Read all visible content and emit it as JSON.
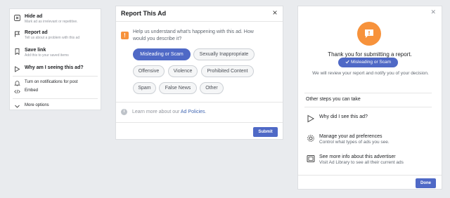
{
  "menu": {
    "hide_ad": {
      "title": "Hide ad",
      "sub": "Mark ad as irrelevant or repetitive."
    },
    "report_ad": {
      "title": "Report ad",
      "sub": "Tell us about a problem with this ad"
    },
    "save_link": {
      "title": "Save link",
      "sub": "Add this to your saved items"
    },
    "why_seeing": {
      "title": "Why am I seeing this ad?"
    },
    "notifications": {
      "label": "Turn on notifications for post"
    },
    "embed": {
      "label": "Embed"
    },
    "more_options": {
      "label": "More options"
    }
  },
  "report": {
    "title": "Report This Ad",
    "close_icon": "×",
    "question": "Help us understand what's happening with this ad. How would you describe it?",
    "options": [
      {
        "label": "Misleading or Scam",
        "selected": true
      },
      {
        "label": "Sexually Inappropriate",
        "selected": false
      },
      {
        "label": "Offensive",
        "selected": false
      },
      {
        "label": "Violence",
        "selected": false
      },
      {
        "label": "Prohibited Content",
        "selected": false
      },
      {
        "label": "Spam",
        "selected": false
      },
      {
        "label": "False News",
        "selected": false
      },
      {
        "label": "Other",
        "selected": false
      }
    ],
    "learn_prefix": "Learn more about our ",
    "learn_link": "Ad Policies",
    "learn_suffix": ".",
    "submit": "Submit"
  },
  "thanks": {
    "title": "Thank you for submitting a report.",
    "badge": "Misleading or Scam",
    "review": "We will review your report and notify you of your decision.",
    "other_steps": "Other steps you can take",
    "why": {
      "title": "Why did I see this ad?"
    },
    "preferences": {
      "title": "Manage your ad preferences",
      "sub": "Control what types of ads you see."
    },
    "advertiser": {
      "title": "See more info about this advertiser",
      "sub": "Visit Ad Library to see all their current ads"
    },
    "done": "Done"
  },
  "colors": {
    "accent": "#4f69c6",
    "warning": "#f7923b",
    "link": "#4267b2"
  }
}
